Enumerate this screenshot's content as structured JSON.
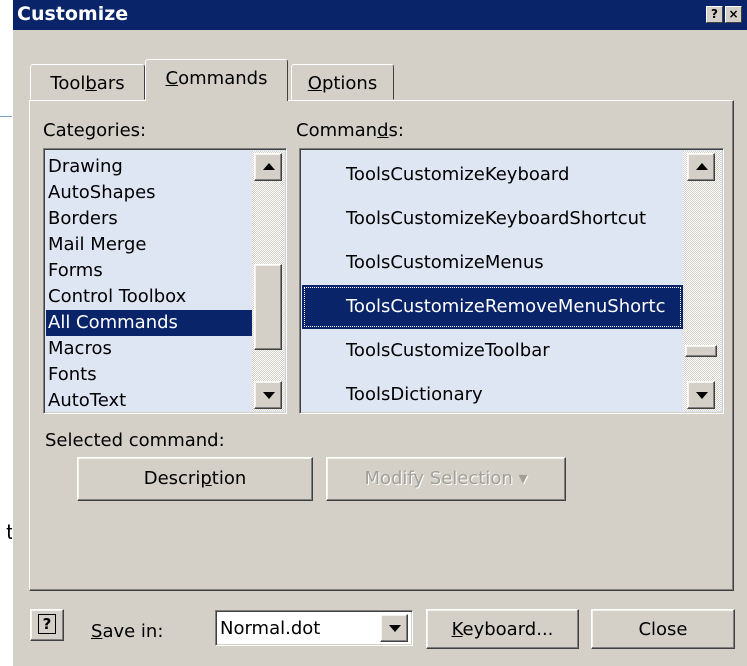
{
  "window": {
    "title": "Customize",
    "help_button": "?",
    "close_button": "×"
  },
  "tabs": [
    {
      "label_pre": "Tool",
      "label_key": "b",
      "label_post": "ars",
      "active": false
    },
    {
      "label_pre": "",
      "label_key": "C",
      "label_post": "ommands",
      "active": true
    },
    {
      "label_pre": "",
      "label_key": "O",
      "label_post": "ptions",
      "active": false
    }
  ],
  "categories": {
    "label_pre": "Cate",
    "label_key": "g",
    "label_post": "ories:",
    "items": [
      "Drawing",
      "AutoShapes",
      "Borders",
      "Mail Merge",
      "Forms",
      "Control Toolbox",
      "All Commands",
      "Macros",
      "Fonts",
      "AutoText"
    ],
    "selected": "All Commands"
  },
  "commands": {
    "label_pre": "Comman",
    "label_key": "d",
    "label_post": "s:",
    "items": [
      "ToolsCustomizeKeyboard",
      "ToolsCustomizeKeyboardShortcut",
      "ToolsCustomizeMenus",
      "ToolsCustomizeRemoveMenuShortc",
      "ToolsCustomizeToolbar",
      "ToolsDictionary"
    ],
    "selected": "ToolsCustomizeRemoveMenuShortc"
  },
  "selected_command": {
    "label": "Selected command:",
    "description_pre": "Descri",
    "description_key": "p",
    "description_post": "tion",
    "modify_selection": "Modify Selection",
    "modify_arrow": "▾"
  },
  "footer": {
    "help_icon": "?",
    "save_in_key": "S",
    "save_in_post": "ave in:",
    "save_in_value": "Normal.dot",
    "keyboard_key": "K",
    "keyboard_post": "eyboard...",
    "close": "Close"
  },
  "background": {
    "partial_letter": "t"
  },
  "colors": {
    "title_bar": "#0a246a",
    "selection": "#0a246a",
    "list_bg": "#dde6f2",
    "face": "#d4d0c8"
  }
}
